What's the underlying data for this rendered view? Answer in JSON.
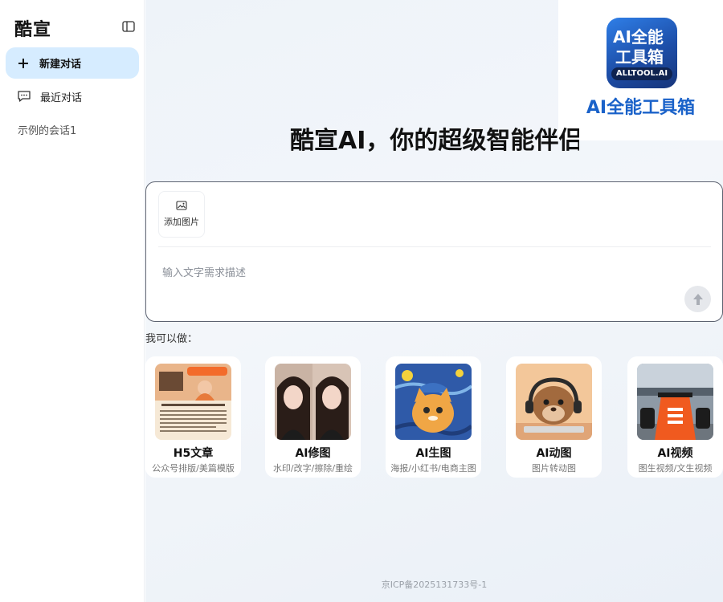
{
  "sidebar": {
    "brand": "酷宣",
    "new_chat": "新建对话",
    "recent": "最近对话",
    "sessions": [
      "示例的会话1"
    ]
  },
  "ad": {
    "logo_line1": "AI全能",
    "logo_line2": "工具箱",
    "logo_badge": "ALLTOOL.AI",
    "name": "AI全能工具箱"
  },
  "headline": "酷宣AI，你的超级智能伴侣",
  "composer": {
    "add_image": "添加图片",
    "placeholder": "输入文字需求描述"
  },
  "features": {
    "heading": "我可以做：",
    "items": [
      {
        "title": "H5文章",
        "subtitle": "公众号排版/美篇模版",
        "image": "teachers-day-article"
      },
      {
        "title": "AI修图",
        "subtitle": "水印/改字/擦除/重绘",
        "image": "portrait-photos"
      },
      {
        "title": "AI生图",
        "subtitle": "海报/小红书/电商主图",
        "image": "starry-night-cat"
      },
      {
        "title": "AI动图",
        "subtitle": "图片转动图",
        "image": "otter-headphones"
      },
      {
        "title": "AI视频",
        "subtitle": "图生视频/文生视频",
        "image": "race-car"
      }
    ]
  },
  "footer": "京ICP备2025131733号-1",
  "colors": {
    "accent": "#d6ecff",
    "brand_blue": "#1a62c9",
    "border": "#5c6270"
  }
}
